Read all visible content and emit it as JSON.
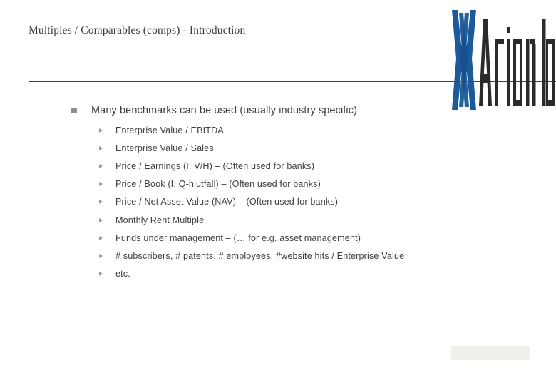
{
  "slide": {
    "title": "Multiples / Comparables (comps) - Introduction",
    "logo": {
      "name": "arion-banki-logo",
      "wordmark": "Arion banki",
      "mark_color": "#1d5a99",
      "wordmark_color": "#2b2b2b"
    },
    "divider_color": "#3f4346",
    "bullets": [
      {
        "level": 1,
        "marker": "square-bullet-icon",
        "text": "Many benchmarks can be used (usually industry specific)"
      },
      {
        "level": 2,
        "marker": "triangle-bullet-icon",
        "text": "Enterprise Value / EBITDA"
      },
      {
        "level": 2,
        "marker": "triangle-bullet-icon",
        "text": "Enterprise Value / Sales"
      },
      {
        "level": 2,
        "marker": "triangle-bullet-icon",
        "text": "Price / Earnings (I: V/H) – (Often used for banks)"
      },
      {
        "level": 2,
        "marker": "triangle-bullet-icon",
        "text": "Price / Book (I: Q-hlutfall) – (Often used for banks)"
      },
      {
        "level": 2,
        "marker": "triangle-bullet-icon",
        "text": "Price / Net Asset Value (NAV) – (Often used for banks)"
      },
      {
        "level": 2,
        "marker": "triangle-bullet-icon",
        "text": "Monthly Rent Multiple"
      },
      {
        "level": 2,
        "marker": "triangle-bullet-icon",
        "text": "Funds under management – (… for e.g. asset management)"
      },
      {
        "level": 2,
        "marker": "triangle-bullet-icon",
        "text": "# subscribers, # patents, # employees, #website hits / Enterprise Value"
      },
      {
        "level": 2,
        "marker": "triangle-bullet-icon",
        "text": "etc."
      }
    ],
    "footer_box": {
      "name": "footer-placeholder",
      "color": "#f1efe9",
      "text": ""
    }
  }
}
